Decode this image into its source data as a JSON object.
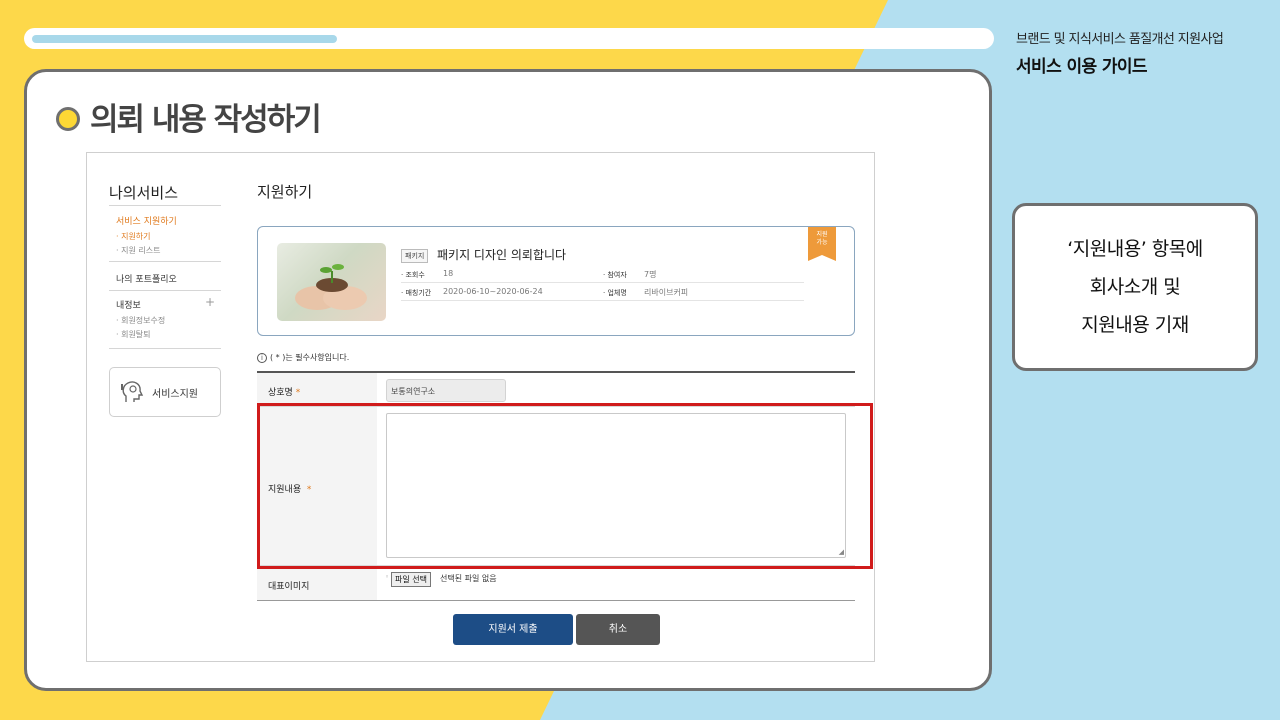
{
  "header": {
    "subtitle": "브랜드 및 지식서비스 품질개선 지원사업",
    "title": "서비스 이용 가이드",
    "progress": 0.32
  },
  "section": {
    "title": "의뢰 내용 작성하기"
  },
  "sidebar": {
    "title": "나의서비스",
    "menu_service": "서비스 지원하기",
    "menu_apply": "· 지원하기",
    "menu_list": "· 지원 리스트",
    "menu_portfolio": "나의 포트폴리오",
    "menu_info": "내정보",
    "menu_edit": "· 회원정보수정",
    "menu_leave": "· 회원탈퇴",
    "service_support": "서비스지원"
  },
  "page": {
    "heading": "지원하기",
    "card": {
      "tag": "패키지",
      "title": "패키지 디자인 의뢰합니다",
      "views_label": "· 조회수",
      "views_value": "18",
      "participants_label": "· 참여자",
      "participants_value": "7명",
      "period_label": "· 매칭기간",
      "period_value": "2020-06-10~2020-06-24",
      "company_label": "· 업체명",
      "company_value": "리바이브커피",
      "ribbon_line1": "지원",
      "ribbon_line2": "가능"
    },
    "form": {
      "required_note": "( * )는 필수사항입니다.",
      "info_icon": "i",
      "company_label": "상호명",
      "company_value": "보통의연구소",
      "content_label": "지원내용",
      "image_label": "대표이미지",
      "file_button": "파일 선택",
      "file_none": "선택된 파일 없음",
      "star": "*",
      "submit": "지원서 제출",
      "cancel": "취소"
    }
  },
  "note": {
    "line1": "‘지원내용’ 항목에",
    "line2": "회사소개 및",
    "line3": "지원내용 기재"
  }
}
